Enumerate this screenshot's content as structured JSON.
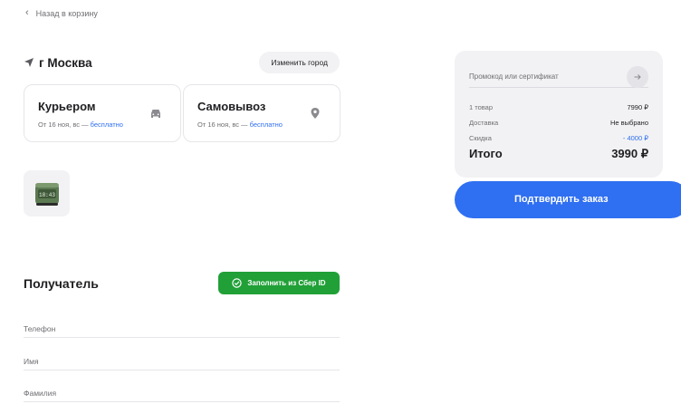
{
  "nav": {
    "back_label": "Назад в корзину"
  },
  "city": {
    "name": "г Москва",
    "change_label": "Изменить город"
  },
  "delivery": {
    "courier": {
      "title": "Курьером",
      "date": "От 16 ноя, вс — ",
      "price": "бесплатно",
      "icon": "car-icon"
    },
    "pickup": {
      "title": "Самовывоз",
      "date": "От 16 ноя, вс — ",
      "price": "бесплатно",
      "icon": "map-pin-icon"
    }
  },
  "product": {
    "thumb_text": "18:43"
  },
  "recipient": {
    "title": "Получатель",
    "sber_label": "Заполнить из Сбер ID",
    "fields": {
      "phone": "Телефон",
      "name": "Имя",
      "surname": "Фамилия"
    }
  },
  "summary": {
    "promo_placeholder": "Промокод или сертификат",
    "items_label": "1 товар",
    "items_value": "7990 ₽",
    "delivery_label": "Доставка",
    "delivery_value": "Не выбрано",
    "discount_label": "Скидка",
    "discount_value": "- 4000 ₽",
    "total_label": "Итого",
    "total_value": "3990 ₽",
    "confirm_label": "Подтвердить заказ"
  },
  "colors": {
    "accent": "#2f6ff1",
    "sber": "#21a038",
    "panel": "#f2f2f4"
  }
}
